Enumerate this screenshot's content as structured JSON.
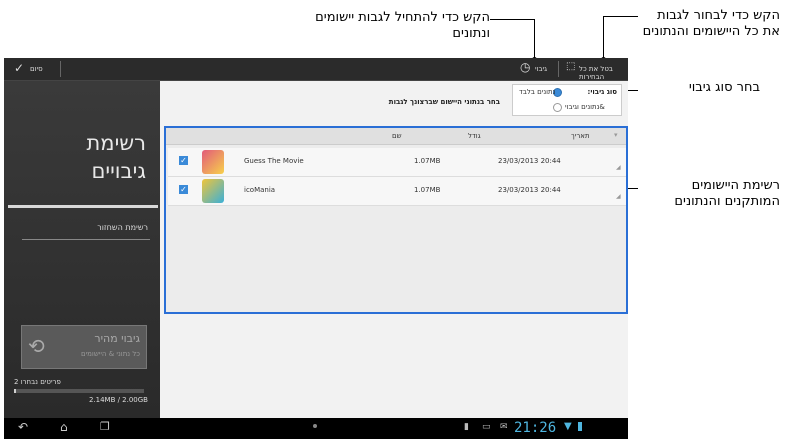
{
  "annotations": {
    "start_backup": "הקש כדי להתחיל לגבות יישומים ונתונים",
    "select_all": "הקש כדי לבחור לגבות את כל היישומים והנתונים",
    "backup_type": "בחר סוג גיבוי",
    "app_list": "רשימת היישומים המותקנים והנתונים"
  },
  "action_bar": {
    "done_label": "סיום",
    "backup_label": "גיבוי",
    "select_all_label": "בטל את כל הבחירות"
  },
  "left_panel": {
    "title": "רשימת גיבויים",
    "restore_list": "רשימת השחזור",
    "quick_backup": "גיבוי מהיר",
    "quick_backup_sub": "כל נתוני & היישומים",
    "selection_status": "2 פריטים נבחרו",
    "storage": "2.14MB / 2.00GB"
  },
  "content": {
    "backup_type_label": "סוג גיבוי:",
    "option_data_only": "נתונים בלבד",
    "option_app_data": "&נתונים וגיבוי",
    "selected_option": "נתונים בלבד",
    "instruction": "בחר בנתוני היישום שברצונך לגבות",
    "columns": [
      "שם",
      "גודל",
      "תאריך"
    ],
    "rows": [
      {
        "name": "Guess The Movie",
        "size": "1.07MB",
        "date": "23/03/2013 20:44",
        "checked": true
      },
      {
        "name": "icoMania",
        "size": "1.07MB",
        "date": "23/03/2013 20:44",
        "checked": true
      }
    ]
  },
  "status_bar": {
    "time": "21:26"
  },
  "colors": {
    "accent": "#3a8ad8",
    "highlight": "#7a9a2a",
    "clock": "#4fb6e0"
  }
}
